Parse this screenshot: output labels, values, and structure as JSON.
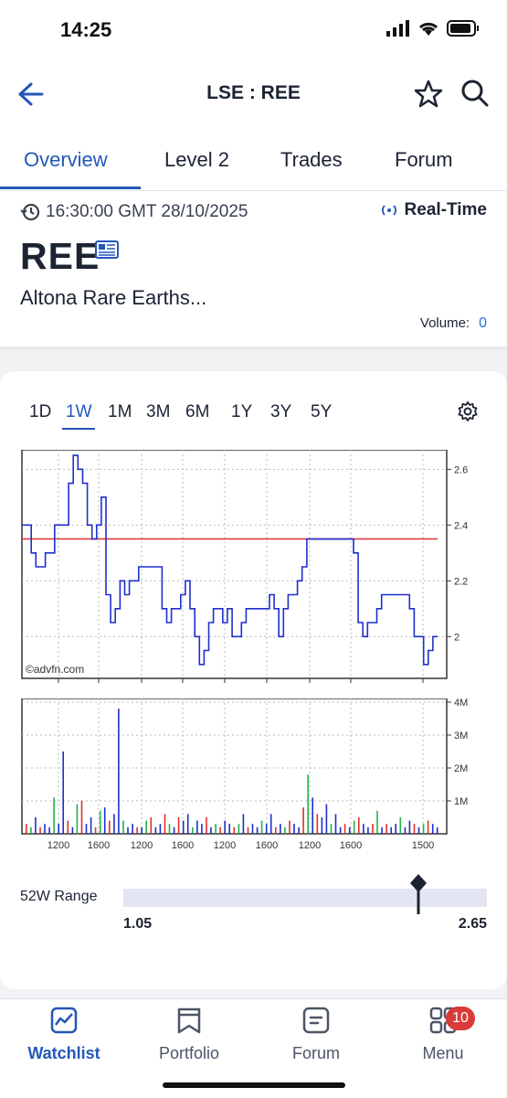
{
  "status": {
    "time": "14:25"
  },
  "header": {
    "title": "LSE : REE"
  },
  "tabs": [
    "Overview",
    "Level 2",
    "Trades",
    "Forum"
  ],
  "quote": {
    "timestamp": "16:30:00 GMT 28/10/2025",
    "realtime_label": "Real-Time",
    "ticker": "REE",
    "company": "Altona Rare Earths...",
    "volume_label": "Volume:",
    "volume_value": "0"
  },
  "ranges": [
    "1D",
    "1W",
    "1M",
    "3M",
    "6M",
    "1Y",
    "3Y",
    "5Y"
  ],
  "selected_range": "1W",
  "chart_data": [
    {
      "type": "line",
      "x_tick_labels": [
        "1200",
        "1600",
        "1200",
        "1600",
        "1200",
        "1600",
        "1200",
        "1600",
        "1500"
      ],
      "y_tick_labels": [
        "2.6",
        "2.4",
        "2.2",
        "2"
      ],
      "ylim": [
        1.85,
        2.67
      ],
      "reference_line": 2.35,
      "watermark": "©advfn.com",
      "series": [
        {
          "values": [
            2.4,
            2.4,
            2.3,
            2.25,
            2.25,
            2.3,
            2.3,
            2.4,
            2.4,
            2.4,
            2.55,
            2.65,
            2.6,
            2.55,
            2.4,
            2.35,
            2.4,
            2.5,
            2.15,
            2.05,
            2.1,
            2.2,
            2.15,
            2.2,
            2.2,
            2.25,
            2.25,
            2.25,
            2.25,
            2.25,
            2.1,
            2.05,
            2.1,
            2.1,
            2.15,
            2.2,
            2.1,
            2.0,
            1.9,
            1.95,
            2.05,
            2.1,
            2.1,
            2.05,
            2.1,
            2.0,
            2.0,
            2.05,
            2.1,
            2.1,
            2.1,
            2.1,
            2.1,
            2.15,
            2.1,
            2.0,
            2.1,
            2.15,
            2.15,
            2.2,
            2.25,
            2.35,
            2.35,
            2.35,
            2.35,
            2.35,
            2.35,
            2.35,
            2.35,
            2.35,
            2.35,
            2.3,
            2.05,
            2.0,
            2.05,
            2.05,
            2.1,
            2.15,
            2.15,
            2.15,
            2.15,
            2.15,
            2.15,
            2.1,
            2.0,
            2.0,
            1.9,
            1.95,
            2.0,
            2.0
          ]
        }
      ],
      "colors": {
        "line": "#1e2fcc",
        "reference": "#e0302a"
      }
    },
    {
      "type": "bar",
      "y_tick_labels": [
        "4M",
        "3M",
        "2M",
        "1M"
      ],
      "ylim": [
        0,
        4
      ],
      "unit": "M",
      "values": [
        0.3,
        0.2,
        0.5,
        0.2,
        0.3,
        0.2,
        1.1,
        0.3,
        2.5,
        0.4,
        0.2,
        0.9,
        1.0,
        0.3,
        0.5,
        0.2,
        0.7,
        0.8,
        0.4,
        0.6,
        3.8,
        0.4,
        0.2,
        0.3,
        0.2,
        0.2,
        0.4,
        0.5,
        0.2,
        0.3,
        0.6,
        0.3,
        0.2,
        0.5,
        0.4,
        0.6,
        0.2,
        0.4,
        0.3,
        0.5,
        0.2,
        0.3,
        0.2,
        0.4,
        0.3,
        0.2,
        0.3,
        0.6,
        0.2,
        0.3,
        0.2,
        0.4,
        0.3,
        0.6,
        0.2,
        0.3,
        0.2,
        0.4,
        0.3,
        0.2,
        0.8,
        1.8,
        1.1,
        0.6,
        0.5,
        0.9,
        0.3,
        0.6,
        0.2,
        0.3,
        0.2,
        0.4,
        0.5,
        0.3,
        0.2,
        0.3,
        0.7,
        0.2,
        0.3,
        0.2,
        0.3,
        0.5,
        0.2,
        0.4,
        0.3,
        0.2,
        0.3,
        0.4,
        0.3,
        0.2
      ],
      "colors": [
        "#1e2fcc",
        "#e0302a",
        "#22b14c"
      ]
    }
  ],
  "week52": {
    "label": "52W Range",
    "low": "1.05",
    "high": "2.65",
    "current": 2.35
  },
  "bottom_nav": [
    {
      "label": "Watchlist"
    },
    {
      "label": "Portfolio"
    },
    {
      "label": "Forum"
    },
    {
      "label": "Menu",
      "badge": "10"
    }
  ]
}
